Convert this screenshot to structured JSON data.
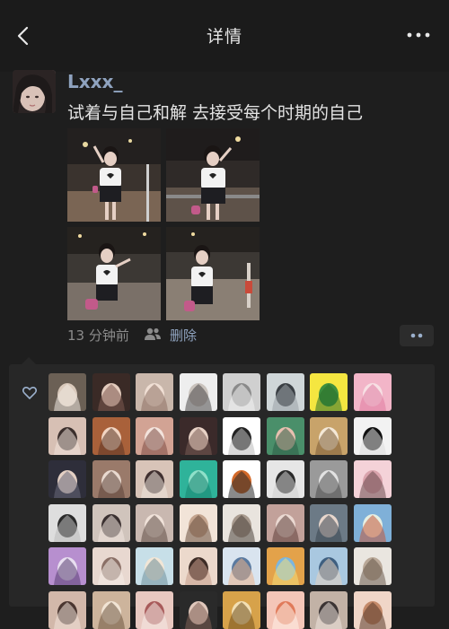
{
  "header": {
    "title": "详情"
  },
  "post": {
    "username": "Lxxx_",
    "text": "试着与自己和解 去接受每个时期的自己",
    "time": "13 分钟前",
    "delete_label": "删除"
  },
  "likes": {
    "rows": 6,
    "per_row": 8
  }
}
